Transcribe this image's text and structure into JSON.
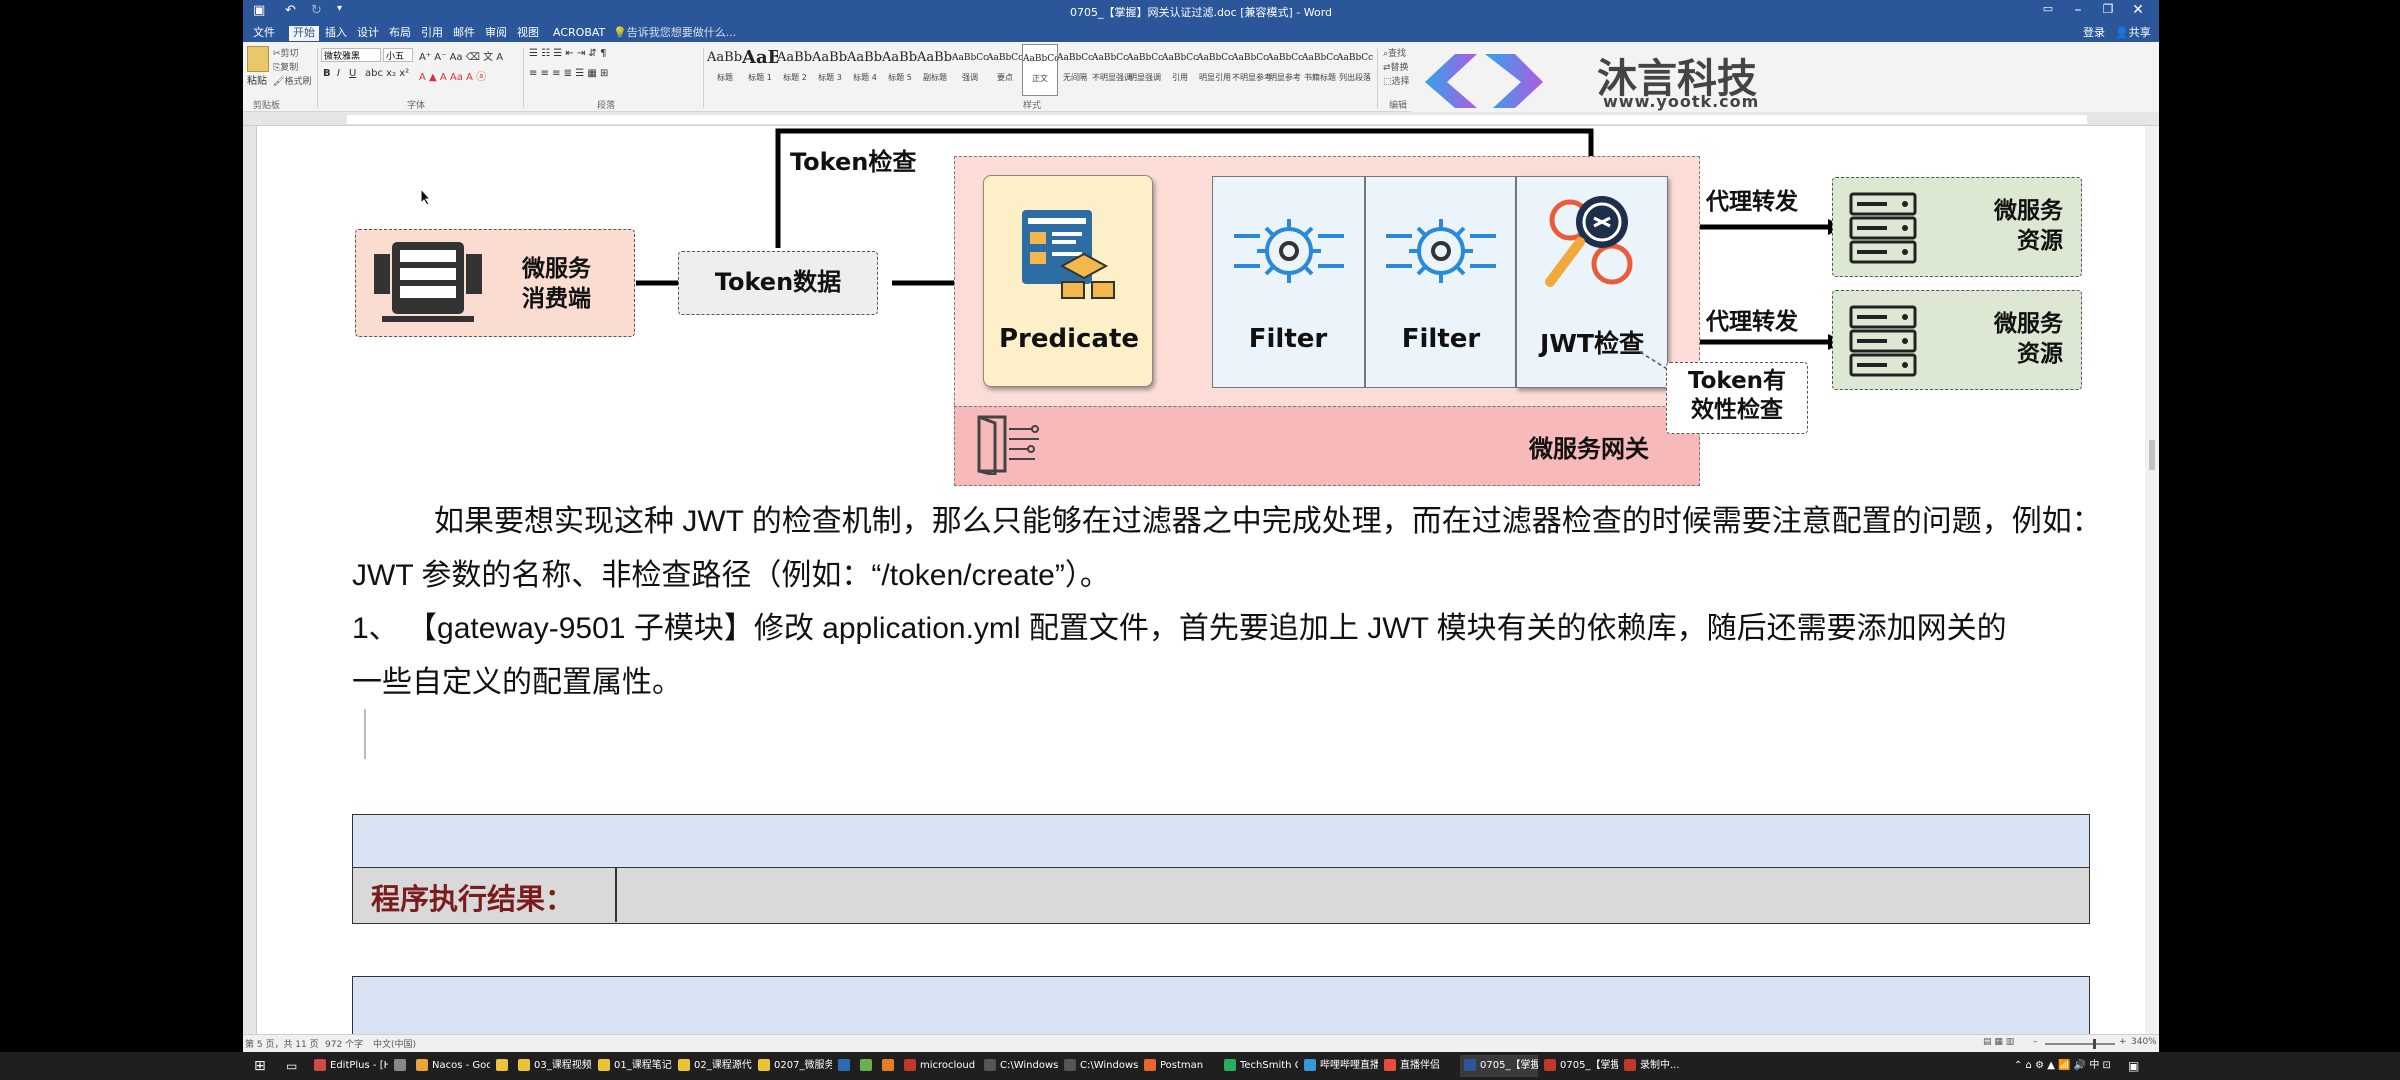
{
  "window": {
    "title": "0705_【掌握】网关认证过滤.doc [兼容模式] - Word",
    "login": "登录",
    "share": "共享"
  },
  "menu": [
    "文件",
    "开始",
    "插入",
    "设计",
    "布局",
    "引用",
    "邮件",
    "审阅",
    "视图",
    "ACROBAT"
  ],
  "tell_me": "告诉我您想要做什么...",
  "ribbon": {
    "paste": "粘贴",
    "cut": "剪切",
    "copy": "复制",
    "format_painter": "格式刷",
    "font_name": "微软雅黑",
    "font_size": "小五",
    "groups": [
      "剪贴板",
      "字体",
      "段落",
      "样式",
      "编辑"
    ],
    "find": "查找",
    "replace": "替换",
    "select": "选择",
    "styles": [
      {
        "sample": "AaBbC",
        "name": "标题"
      },
      {
        "sample": "AaBl",
        "name": "标题 1"
      },
      {
        "sample": "AaBbC",
        "name": "标题 2"
      },
      {
        "sample": "AaBbC",
        "name": "标题 3"
      },
      {
        "sample": "AaBbC",
        "name": "标题 4"
      },
      {
        "sample": "AaBbC",
        "name": "标题 5"
      },
      {
        "sample": "AaBbC",
        "name": "副标题"
      },
      {
        "sample": "AaBbCcDı",
        "name": "强调"
      },
      {
        "sample": "AaBbCcD",
        "name": "要点"
      },
      {
        "sample": "AaBbCcDc",
        "name": "正文"
      },
      {
        "sample": "AaBbCcDc",
        "name": "无间隔"
      },
      {
        "sample": "AaBbCcDı",
        "name": "不明显强调"
      },
      {
        "sample": "AaBbCcDı",
        "name": "明显强调"
      },
      {
        "sample": "AaBbCcDı",
        "name": "引用"
      },
      {
        "sample": "AaBbCcDı",
        "name": "明显引用"
      },
      {
        "sample": "AaBbCcD",
        "name": "不明显参考"
      },
      {
        "sample": "AaBbCcI",
        "name": "明显参考"
      },
      {
        "sample": "AaBbCcD",
        "name": "书籍标题"
      },
      {
        "sample": "AaBbCcDc",
        "name": "列出段落"
      }
    ]
  },
  "watermark": {
    "brand": "沐言科技",
    "url": "www.yootk.com"
  },
  "diagram": {
    "token_check": "Token检查",
    "consumer": "微服务\n消费端",
    "token_data": "Token数据",
    "predicate": "Predicate",
    "filter1": "Filter",
    "filter2": "Filter",
    "jwt_check": "JWT检查",
    "token_validity": "Token有\n效性检查",
    "gateway": "微服务网关",
    "proxy1": "代理转发",
    "proxy2": "代理转发",
    "resource1": "微服务\n资源",
    "resource2": "微服务\n资源"
  },
  "document": {
    "p1_line1": "如果要想实现这种 JWT 的检查机制，那么只能够在过滤器之中完成处理，而在过滤器检查的时候需要注意配置的问题，例如：",
    "p1_line2": "JWT 参数的名称、非检查路径（例如：“/token/create”）。",
    "p2_line1": "1、  【gateway-9501 子模块】修改 application.yml 配置文件，首先要追加上 JWT 模块有关的依赖库，随后还需要添加网关的",
    "p2_line2": "一些自定义的配置属性。",
    "result_label": "程序执行结果："
  },
  "status": {
    "page": "第 5 页，共 11 页",
    "words": "972 个字",
    "lang": "中文(中国)",
    "zoom": "340%"
  },
  "taskbar": [
    {
      "label": "EditPlus - [H...",
      "color": "#d04a4a"
    },
    {
      "label": "",
      "color": "#888"
    },
    {
      "label": "Nacos - Goo...",
      "color": "#e8a33b"
    },
    {
      "label": "",
      "color": "#e8c33b"
    },
    {
      "label": "03_课程视频",
      "color": "#e8c33b"
    },
    {
      "label": "01_课程笔记",
      "color": "#e8c33b"
    },
    {
      "label": "02_课程源代码",
      "color": "#e8c33b"
    },
    {
      "label": "0207_微服务...",
      "color": "#e8c33b"
    },
    {
      "label": "",
      "color": "#2b6cb0"
    },
    {
      "label": "",
      "color": "#6ab04c"
    },
    {
      "label": "",
      "color": "#e67e22"
    },
    {
      "label": "microcloud ...",
      "color": "#c0392b"
    },
    {
      "label": "C:\\Windows\\...",
      "color": "#555"
    },
    {
      "label": "C:\\Windows\\...",
      "color": "#555"
    },
    {
      "label": "Postman",
      "color": "#e8662b"
    },
    {
      "label": "TechSmith C...",
      "color": "#27ae60"
    },
    {
      "label": "哔哩哔哩直播...",
      "color": "#3498db"
    },
    {
      "label": "直播伴侣",
      "color": "#e74c3c"
    },
    {
      "label": "0705_【掌握...",
      "color": "#2b579a"
    },
    {
      "label": "0705_【掌握...",
      "color": "#c0392b"
    },
    {
      "label": "录制中...",
      "color": "#c0392b"
    }
  ]
}
